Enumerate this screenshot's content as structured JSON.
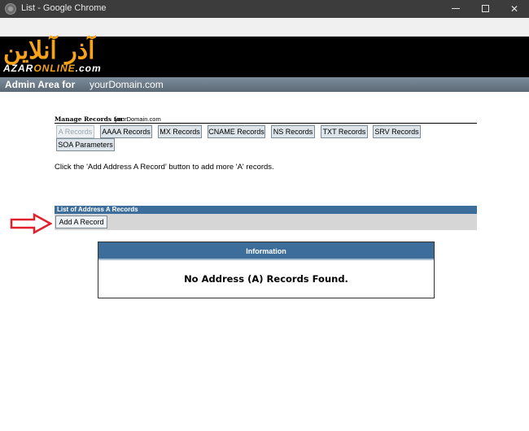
{
  "window": {
    "title": "List - Google Chrome",
    "minimize_icon": "minimize-icon",
    "maximize_icon": "maximize-icon",
    "close_label": "✕"
  },
  "header": {
    "logo_persian": "آذر آنلاین",
    "logo_latin_a": "AZAR",
    "logo_latin_b": "ONLINE",
    "logo_latin_c": ".com",
    "admin_label": "Admin Area for",
    "admin_domain": "yourDomain.com"
  },
  "manage": {
    "label": "Manage Records for",
    "domain": "yourDomain.com",
    "tabs": [
      {
        "label": "A Records"
      },
      {
        "label": "AAAA Records"
      },
      {
        "label": "MX Records"
      },
      {
        "label": "CNAME Records"
      },
      {
        "label": "NS Records"
      },
      {
        "label": "TXT Records"
      },
      {
        "label": "SRV Records"
      },
      {
        "label": "SOA Parameters"
      }
    ],
    "active_tab": "A Records",
    "hint": "Click the 'Add Address A Record' button to add more 'A' records."
  },
  "list": {
    "title": "List of Address A Records",
    "add_button": "Add A Record"
  },
  "info": {
    "title": "Information",
    "message": "No Address (A) Records Found."
  },
  "colors": {
    "accent_blue": "#3d6d9a",
    "logo_orange": "#f6a31b",
    "arrow_red": "#e0202a"
  }
}
